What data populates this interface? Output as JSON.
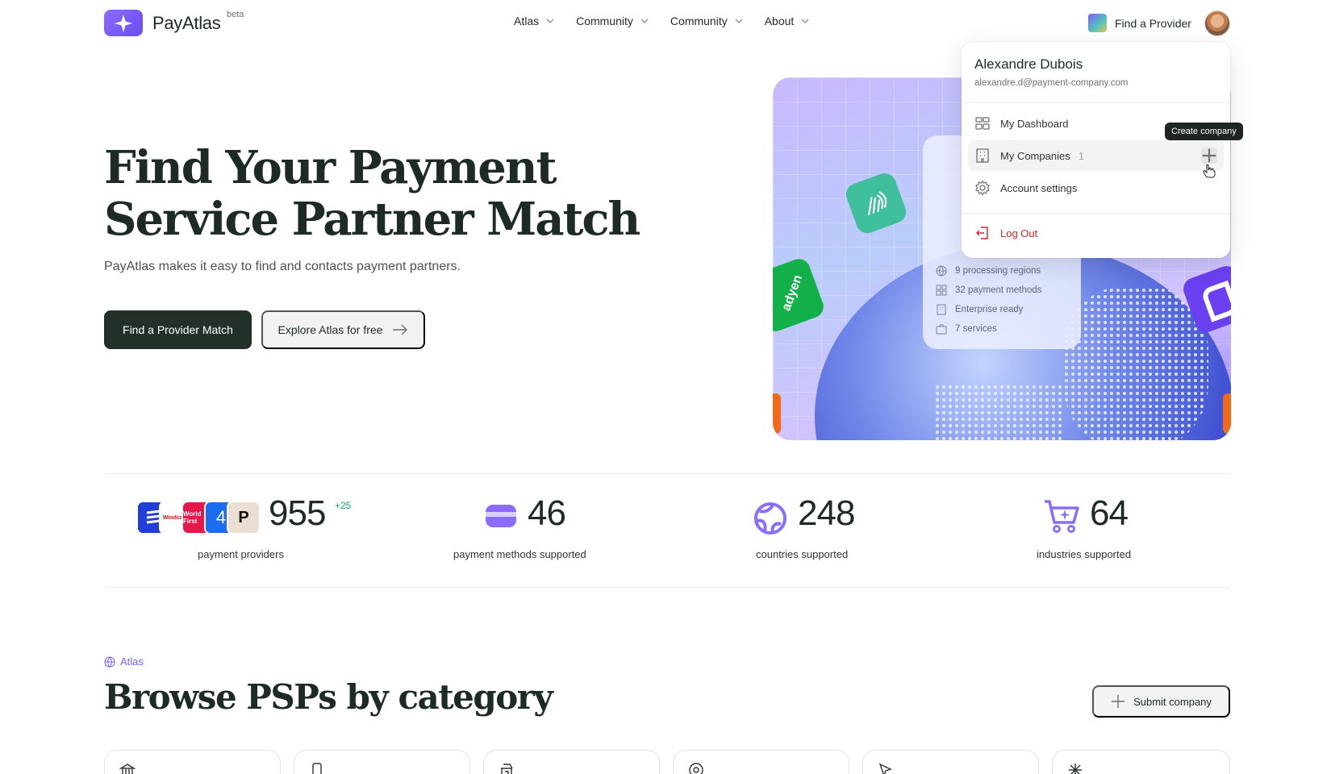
{
  "header": {
    "brand": "PayAtlas",
    "brand_badge": "beta",
    "nav": [
      {
        "label": "Atlas"
      },
      {
        "label": "Community"
      },
      {
        "label": "Community"
      },
      {
        "label": "About"
      }
    ],
    "find_provider": "Find a Provider"
  },
  "hero": {
    "title_line1": "Find Your Payment",
    "title_line2": "Service Partner Match",
    "subtitle": "PayAtlas makes it easy to find and contacts payment partners.",
    "primary_cta": "Find a Provider Match",
    "secondary_cta": "Explore Atlas for free",
    "card": {
      "stats": [
        {
          "icon": "globe-icon",
          "label": "9 processing regions"
        },
        {
          "icon": "grid-icon",
          "label": "32 payment methods"
        },
        {
          "icon": "building-icon",
          "label": "Enterprise ready"
        },
        {
          "icon": "briefcase-icon",
          "label": "7 services"
        }
      ]
    },
    "tile_label": "adyen"
  },
  "user_menu": {
    "name": "Alexandre Dubois",
    "email": "alexandre.d@payment-company.com",
    "items": [
      {
        "label": "My Dashboard"
      },
      {
        "label": "My Companies",
        "count": "1"
      },
      {
        "label": "Account settings"
      }
    ],
    "logout": "Log Out",
    "tooltip": "Create company"
  },
  "stats": [
    {
      "value": "955",
      "delta": "+25",
      "label": "payment providers"
    },
    {
      "value": "46",
      "label": "payment methods supported"
    },
    {
      "value": "248",
      "label": "countries supported"
    },
    {
      "value": "64",
      "label": "industries supported"
    }
  ],
  "provider_logos": [
    {
      "text": "",
      "color": "#1f3fd6"
    },
    {
      "text": "Windcave",
      "color": "#ffffff"
    },
    {
      "text": "World First",
      "color": "#e5174b"
    },
    {
      "text": "4",
      "color": "#1a6df0"
    },
    {
      "text": "P",
      "color": "#eadfd2"
    }
  ],
  "section": {
    "kicker": "Atlas",
    "title": "Browse PSPs by category",
    "submit": "Submit company"
  },
  "colors": {
    "accent": "#7c5cff",
    "primary_button": "#223029",
    "danger": "#d4262a",
    "positive": "#17a86a"
  }
}
